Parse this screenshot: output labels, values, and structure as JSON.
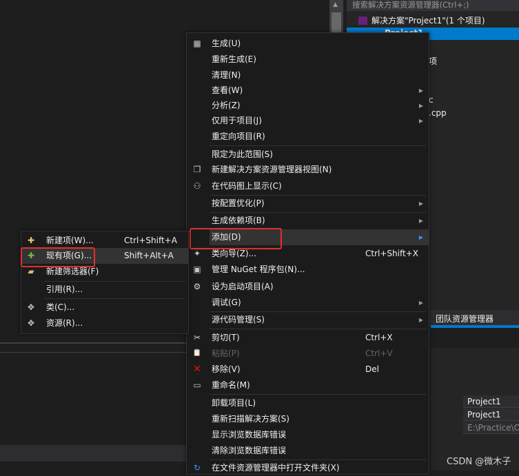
{
  "solution_explorer": {
    "search_placeholder": "搜索解决方案资源管理器(Ctrl+;)",
    "solution_row": "解决方案\"Project1\"(1 个项目)",
    "project_row": "Project1",
    "frag1": "项",
    "frag2": "c",
    "frag3": ".cpp",
    "team_tab": "团队资源管理器"
  },
  "properties": {
    "row1": "Project1",
    "row2": "Project1",
    "row3": "E:\\Practice\\O"
  },
  "watermark": "CSDN @微木子",
  "context_menu": {
    "items": [
      {
        "label": "生成(U)",
        "icon": "build-icon",
        "icon_char": "▦"
      },
      {
        "label": "重新生成(E)"
      },
      {
        "label": "清理(N)"
      },
      {
        "label": "查看(W)"
      },
      {
        "label": "分析(Z)"
      },
      {
        "label": "仅用于项目(J)"
      },
      {
        "label": "重定向项目(R)"
      },
      {
        "label": "限定为此范围(S)"
      },
      {
        "label": "新建解决方案资源管理器视图(N)",
        "icon_char": "❐"
      },
      {
        "label": "在代码图上显示(C)",
        "icon_char": "⚇"
      },
      {
        "label": "按配置优化(P)"
      },
      {
        "label": "生成依赖项(B)"
      },
      {
        "label": "添加(D)"
      },
      {
        "label": "类向导(Z)...",
        "shortcut": "Ctrl+Shift+X",
        "icon_char": "✦"
      },
      {
        "label": "管理 NuGet 程序包(N)...",
        "icon_char": "▣"
      },
      {
        "label": "设为启动项目(A)",
        "icon_char": "⚙"
      },
      {
        "label": "调试(G)"
      },
      {
        "label": "源代码管理(S)"
      },
      {
        "label": "剪切(T)",
        "shortcut": "Ctrl+X",
        "icon_char": "✂"
      },
      {
        "label": "粘贴(P)",
        "shortcut": "Ctrl+V",
        "icon_char": "📋"
      },
      {
        "label": "移除(V)",
        "shortcut": "Del",
        "icon_char": "✕"
      },
      {
        "label": "重命名(M)",
        "icon_char": "▭"
      },
      {
        "label": "卸载项目(L)"
      },
      {
        "label": "重新扫描解决方案(S)"
      },
      {
        "label": "显示浏览数据库错误"
      },
      {
        "label": "清除浏览数据库错误"
      },
      {
        "label": "在文件资源管理器中打开文件夹(X)",
        "icon_char": "↻"
      }
    ]
  },
  "add_submenu": {
    "items": [
      {
        "label": "新建项(W)...",
        "shortcut": "Ctrl+Shift+A",
        "icon_char": "✚"
      },
      {
        "label": "现有项(G)...",
        "shortcut": "Shift+Alt+A",
        "icon_char": "✚"
      },
      {
        "label": "新建筛选器(F)",
        "icon_char": "▰"
      },
      {
        "label": "引用(R)..."
      },
      {
        "label": "类(C)...",
        "icon_char": "✥"
      },
      {
        "label": "资源(R)...",
        "icon_char": "✥"
      }
    ]
  }
}
